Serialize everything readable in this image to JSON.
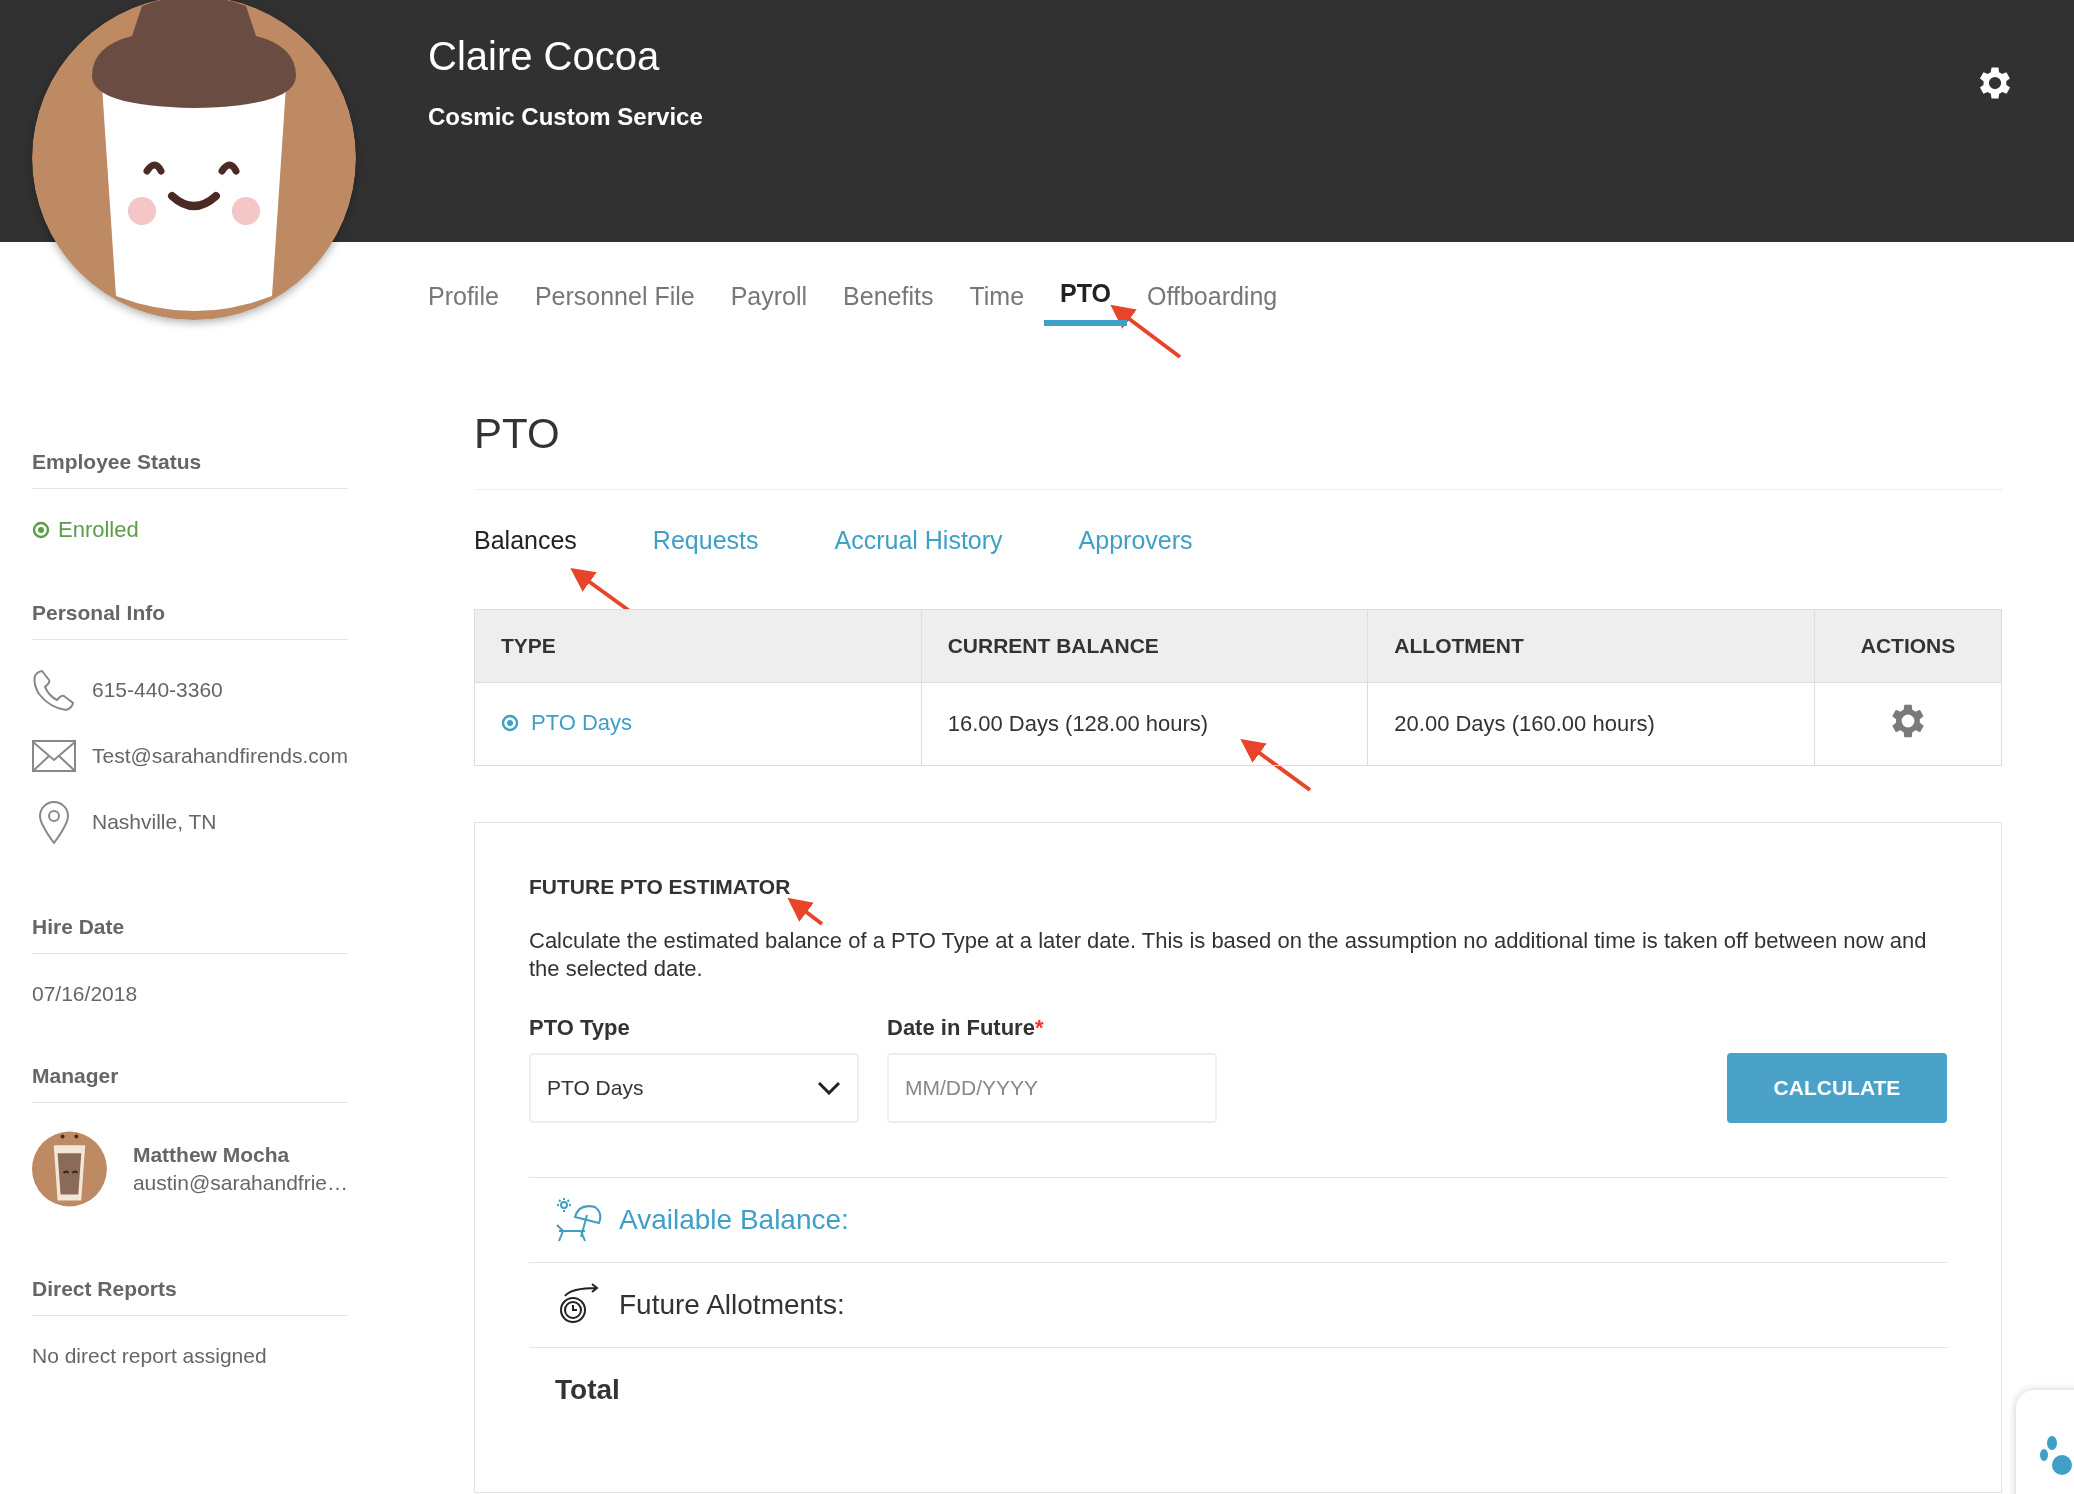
{
  "header": {
    "name": "Claire Cocoa",
    "company": "Cosmic Custom Service"
  },
  "nav_tabs": [
    {
      "label": "Profile",
      "selected": false
    },
    {
      "label": "Personnel File",
      "selected": false
    },
    {
      "label": "Payroll",
      "selected": false
    },
    {
      "label": "Benefits",
      "selected": false
    },
    {
      "label": "Time",
      "selected": false
    },
    {
      "label": "PTO",
      "selected": true
    },
    {
      "label": "Offboarding",
      "selected": false
    }
  ],
  "employee_status": {
    "heading": "Employee Status",
    "status": "Enrolled"
  },
  "personal_info": {
    "heading": "Personal Info",
    "items": [
      {
        "kind": "phone",
        "text": "615-440-3360"
      },
      {
        "kind": "email",
        "text": "Test@sarahandfirends.com"
      },
      {
        "kind": "location",
        "text": "Nashville, TN"
      }
    ]
  },
  "hire_date": {
    "heading": "Hire Date",
    "value": "07/16/2018"
  },
  "manager": {
    "heading": "Manager",
    "name": "Matthew Mocha",
    "email": "austin@sarahandfrie…"
  },
  "direct_reports": {
    "heading": "Direct Reports",
    "value": "No direct report assigned"
  },
  "page_title": "PTO",
  "sub_tabs": [
    {
      "label": "Balances",
      "selected": true
    },
    {
      "label": "Requests",
      "selected": false
    },
    {
      "label": "Accrual History",
      "selected": false
    },
    {
      "label": "Approvers",
      "selected": false
    }
  ],
  "table": {
    "columns": [
      "TYPE",
      "CURRENT BALANCE",
      "ALLOTMENT",
      "ACTIONS"
    ],
    "rows": [
      {
        "type": "PTO Days",
        "current_balance": "16.00 Days (128.00 hours)",
        "allotment": "20.00 Days (160.00 hours)"
      }
    ]
  },
  "estimator": {
    "title": "FUTURE PTO ESTIMATOR",
    "description": "Calculate the estimated balance of a PTO Type at a later date. This is based on the assumption no additional time is taken off between now and the selected date.",
    "pto_type": {
      "label": "PTO Type",
      "value": "PTO Days"
    },
    "date": {
      "label": "Date in Future",
      "required_mark": "*",
      "placeholder": "MM/DD/YYYY"
    },
    "button": "CALCULATE",
    "results": [
      {
        "kind": "available",
        "label": "Available Balance:"
      },
      {
        "kind": "future",
        "label": "Future Allotments:"
      },
      {
        "kind": "total",
        "label": "Total"
      }
    ]
  }
}
